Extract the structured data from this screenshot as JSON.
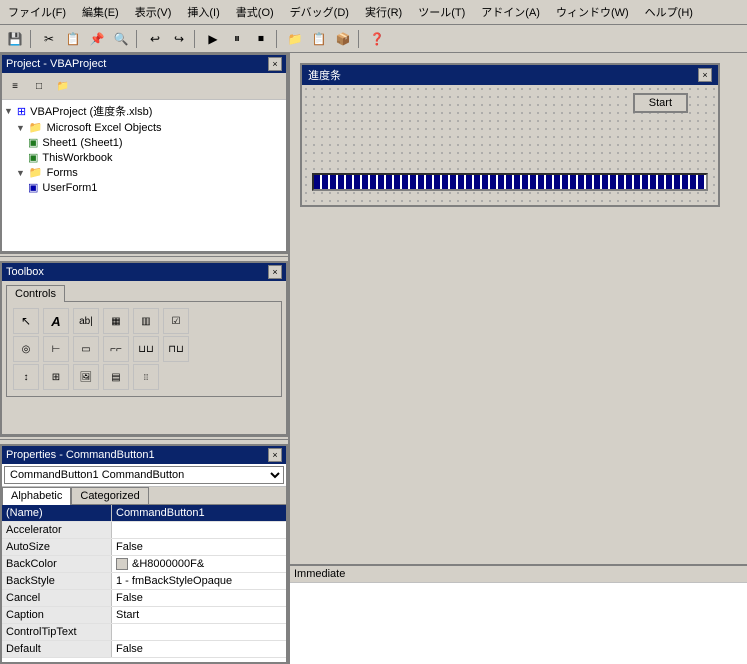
{
  "menubar": {
    "items": [
      "ファイル(F)",
      "編集(E)",
      "表示(V)",
      "挿入(I)",
      "書式(O)",
      "デバッグ(D)",
      "実行(R)",
      "ツール(T)",
      "アドイン(A)",
      "ウィンドウ(W)",
      "ヘルプ(H)"
    ]
  },
  "project_window": {
    "title": "Project - VBAProject",
    "close_label": "×",
    "tree": [
      {
        "label": "VBAProject (進度条.xlsb)",
        "level": 0,
        "icon": "vba",
        "expanded": true
      },
      {
        "label": "Microsoft Excel Objects",
        "level": 1,
        "icon": "folder",
        "expanded": true
      },
      {
        "label": "Sheet1 (Sheet1)",
        "level": 2,
        "icon": "sheet"
      },
      {
        "label": "ThisWorkbook",
        "level": 2,
        "icon": "workbook"
      },
      {
        "label": "Forms",
        "level": 1,
        "icon": "folder",
        "expanded": true
      },
      {
        "label": "UserForm1",
        "level": 2,
        "icon": "form"
      }
    ]
  },
  "toolbox": {
    "title": "Toolbox",
    "close_label": "×",
    "tab": "Controls",
    "tools": [
      "↖",
      "A",
      "ab|",
      "▦",
      "▥",
      "☑",
      "◎",
      "⊢",
      "▣",
      "⌐",
      "⌐",
      "⊔",
      "⊔",
      "⊓",
      "☰",
      "▦",
      "▤",
      "⊟",
      "⊞",
      "⁞⁞"
    ]
  },
  "properties_window": {
    "title": "Properties - CommandButton1",
    "close_label": "×",
    "object_name": "CommandButton1  CommandButton",
    "tabs": [
      "Alphabetic",
      "Categorized"
    ],
    "active_tab": "Alphabetic",
    "rows": [
      {
        "key": "(Name)",
        "value": "CommandButton1",
        "selected": true
      },
      {
        "key": "Accelerator",
        "value": ""
      },
      {
        "key": "AutoSize",
        "value": "False"
      },
      {
        "key": "BackColor",
        "value": "&H8000000F&",
        "has_swatch": true,
        "swatch_color": "#d4d0c8"
      },
      {
        "key": "BackStyle",
        "value": "1 - fmBackStyleOpaque"
      },
      {
        "key": "Cancel",
        "value": "False"
      },
      {
        "key": "Caption",
        "value": "Start"
      },
      {
        "key": "ControlTipText",
        "value": ""
      },
      {
        "key": "Default",
        "value": "False"
      }
    ]
  },
  "form_window": {
    "title": "進度条",
    "close_label": "×",
    "button_label": "Start"
  },
  "immediate_window": {
    "title": "Immediate"
  },
  "colors": {
    "titlebar_active": "#0a246a",
    "titlebar_text": "#ffffff",
    "window_bg": "#d4d0c8",
    "selected_row": "#0a246a",
    "progress_blue": "#000080"
  }
}
